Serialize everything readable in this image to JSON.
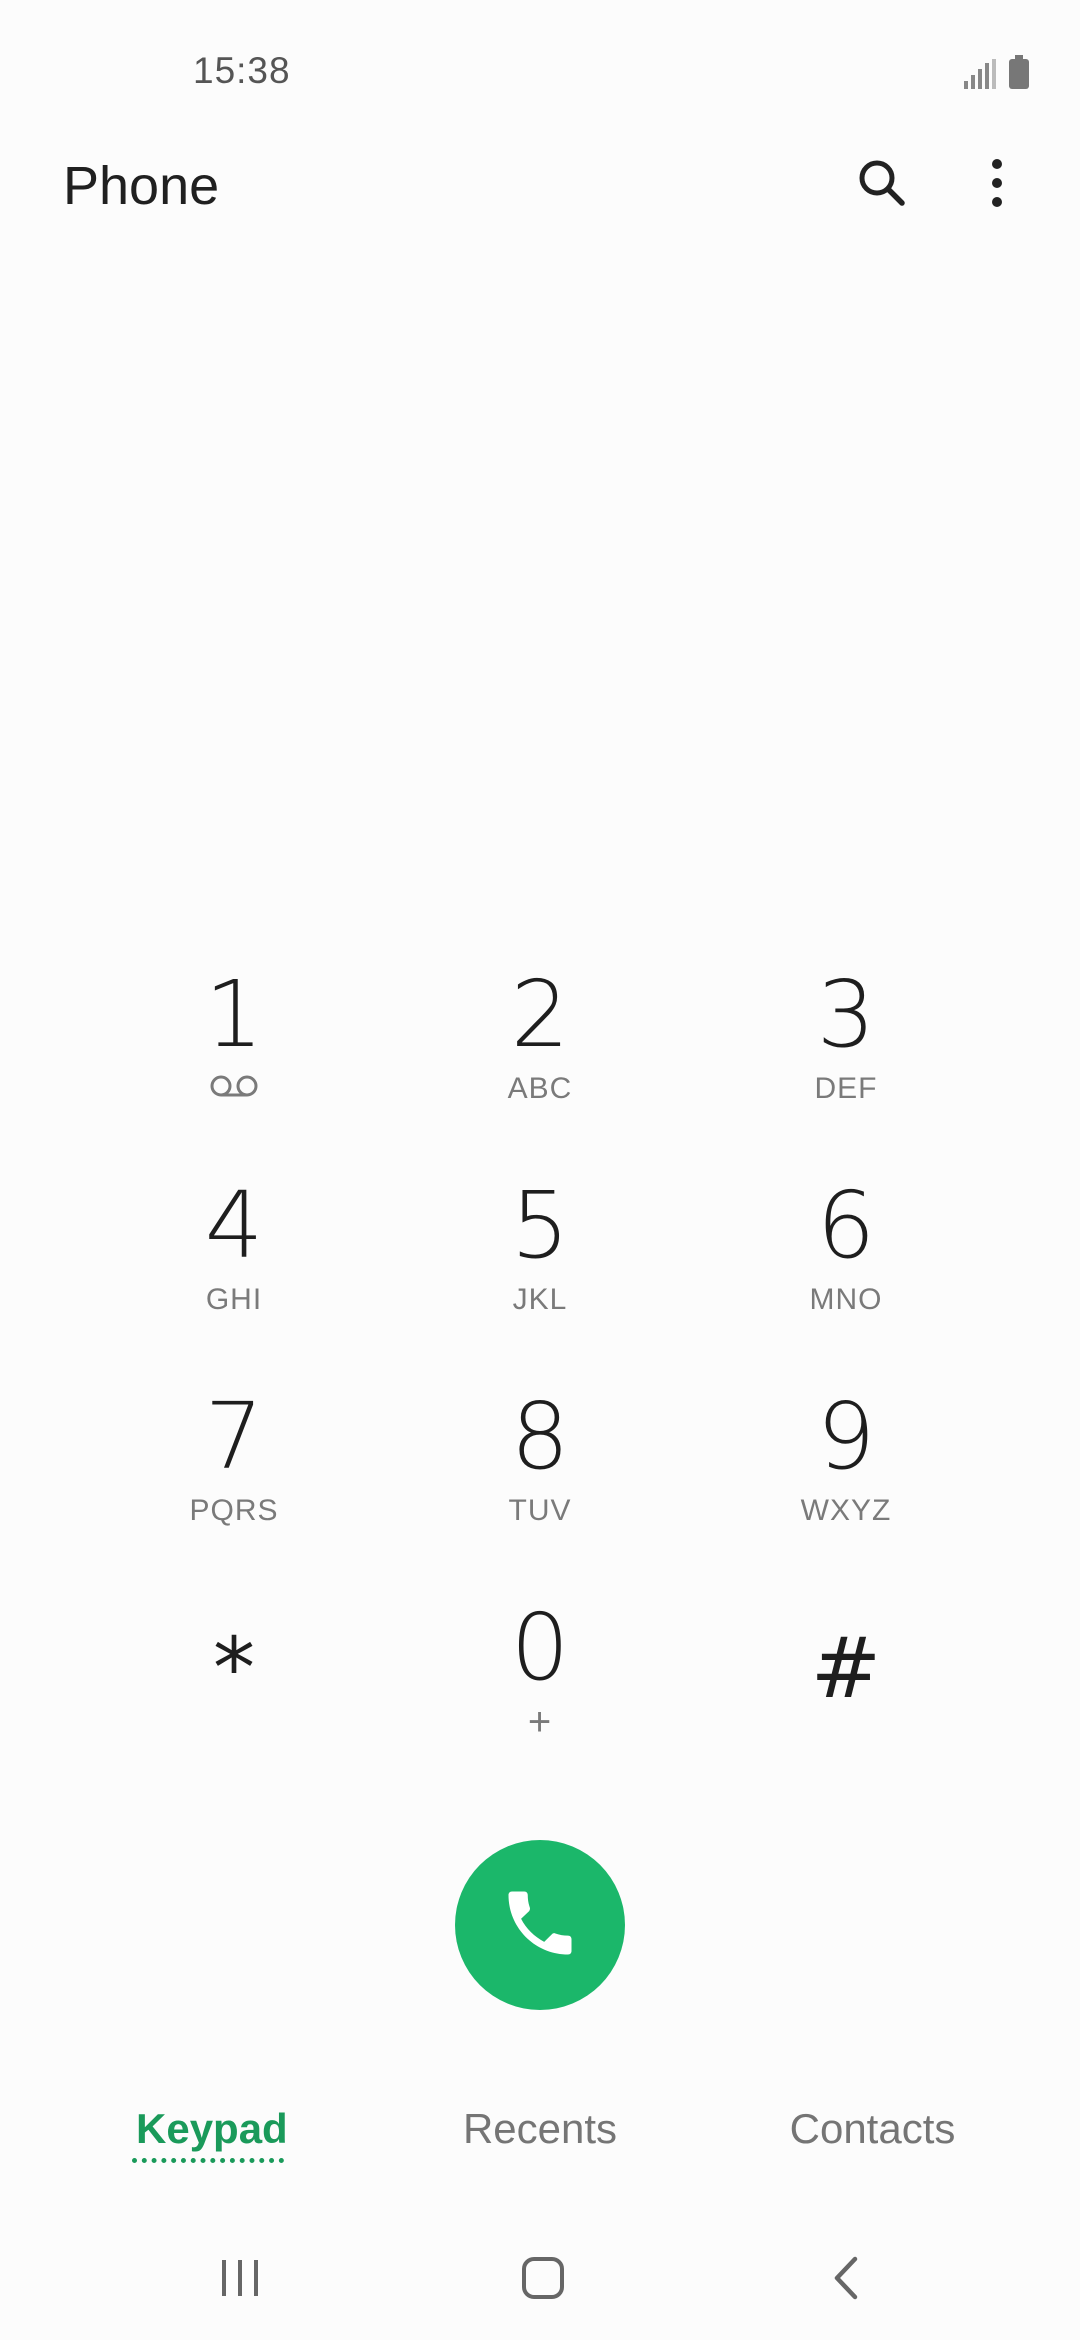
{
  "status_bar": {
    "time": "15:38",
    "icons": [
      "signal-icon",
      "battery-icon"
    ]
  },
  "header": {
    "title": "Phone",
    "actions": [
      "search-icon",
      "more-options-icon"
    ]
  },
  "keypad": {
    "keys": [
      {
        "digit": "1",
        "letters": "",
        "icon": "voicemail-icon"
      },
      {
        "digit": "2",
        "letters": "ABC"
      },
      {
        "digit": "3",
        "letters": "DEF"
      },
      {
        "digit": "4",
        "letters": "GHI"
      },
      {
        "digit": "5",
        "letters": "JKL"
      },
      {
        "digit": "6",
        "letters": "MNO"
      },
      {
        "digit": "7",
        "letters": "PQRS"
      },
      {
        "digit": "8",
        "letters": "TUV"
      },
      {
        "digit": "9",
        "letters": "WXYZ"
      },
      {
        "digit": "*",
        "letters": ""
      },
      {
        "digit": "0",
        "letters": "+"
      },
      {
        "digit": "#",
        "letters": ""
      }
    ]
  },
  "call_button": {
    "icon": "phone-icon",
    "color": "#1bb76a"
  },
  "tabs": [
    {
      "label": "Keypad",
      "active": true
    },
    {
      "label": "Recents",
      "active": false
    },
    {
      "label": "Contacts",
      "active": false
    }
  ],
  "nav_bar": {
    "buttons": [
      "recent-apps-icon",
      "home-icon",
      "back-icon"
    ]
  },
  "colors": {
    "accent": "#1a9a5a",
    "background": "#fcfcfc"
  }
}
